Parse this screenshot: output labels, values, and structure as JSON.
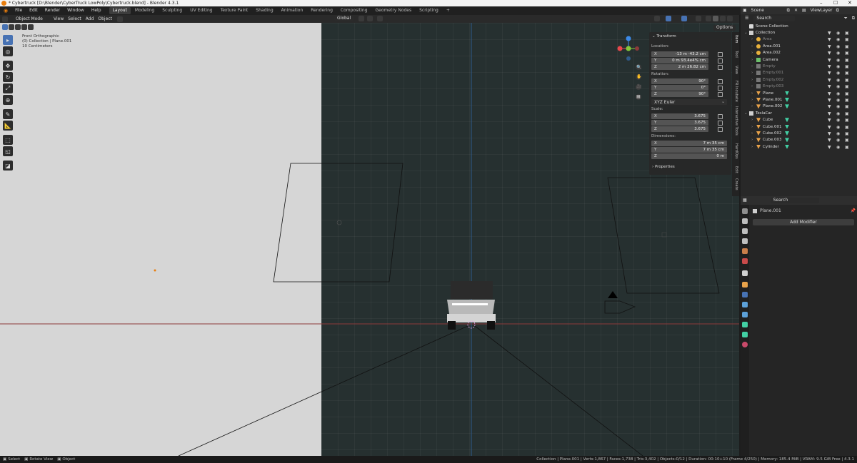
{
  "window": {
    "title": "* Cybertruck [D:\\Blender\\CyberTruck LowPoly\\Cybertruck.blend] - Blender 4.3.1"
  },
  "menu": [
    "File",
    "Edit",
    "Render",
    "Window",
    "Help"
  ],
  "workspaces": [
    "Layout",
    "Modeling",
    "Sculpting",
    "UV Editing",
    "Texture Paint",
    "Shading",
    "Animation",
    "Rendering",
    "Compositing",
    "Geometry Nodes",
    "Scripting"
  ],
  "workspace_add": "+",
  "scene": {
    "name": "Scene",
    "view_layer": "ViewLayer"
  },
  "viewport": {
    "mode": "Object Mode",
    "menus": [
      "View",
      "Select",
      "Add",
      "Object"
    ],
    "orientation": "Global",
    "options_label": "Options",
    "overlay": {
      "line1": "Front Orthographic",
      "line2": "(0) Collection | Plane.001",
      "line3": "10 Centimeters"
    }
  },
  "transform_panel": {
    "title": "Transform",
    "location_label": "Location:",
    "location": {
      "x": "-13 m -43.2 cm",
      "y": "0 m 93.4e4% cm",
      "z": "2 m 26.82 cm"
    },
    "rotation_label": "Rotation:",
    "rotation": {
      "x": "90°",
      "y": "0°",
      "z": "90°"
    },
    "rotation_mode": "XYZ Euler",
    "scale_label": "Scale:",
    "scale": {
      "x": "3.675",
      "y": "3.675",
      "z": "3.675"
    },
    "dimensions_label": "Dimensions:",
    "dimensions": {
      "x": "7 m 35 cm",
      "y": "7 m 35 cm",
      "z": "0 m"
    },
    "properties_label": "Properties",
    "axis_x": "X",
    "axis_y": "Y",
    "axis_z": "Z"
  },
  "sidebar_tabs": [
    "Item",
    "Tool",
    "View",
    "FR Incubate",
    "Interactive Tools",
    "HardOps",
    "Edit",
    "Create"
  ],
  "outliner": {
    "search_placeholder": "Search",
    "root": "Scene Collection",
    "rows": [
      {
        "name": "Collection",
        "kind": "collection",
        "level": 0
      },
      {
        "name": "Area",
        "kind": "light",
        "level": 1,
        "dim": true
      },
      {
        "name": "Area.001",
        "kind": "light",
        "level": 1
      },
      {
        "name": "Area.002",
        "kind": "light",
        "level": 1
      },
      {
        "name": "Camera",
        "kind": "camera",
        "level": 1
      },
      {
        "name": "Empty",
        "kind": "empty",
        "level": 1,
        "dim": true
      },
      {
        "name": "Empty.001",
        "kind": "empty",
        "level": 1,
        "dim": true
      },
      {
        "name": "Empty.002",
        "kind": "empty",
        "level": 1,
        "dim": true
      },
      {
        "name": "Empty.003",
        "kind": "empty",
        "level": 1,
        "dim": true
      },
      {
        "name": "Plane",
        "kind": "mesh",
        "level": 1
      },
      {
        "name": "Plane.001",
        "kind": "mesh",
        "level": 1
      },
      {
        "name": "Plane.002",
        "kind": "mesh",
        "level": 1
      },
      {
        "name": "TeslaCar",
        "kind": "collection",
        "level": 0
      },
      {
        "name": "Cube",
        "kind": "mesh",
        "level": 1
      },
      {
        "name": "Cube.001",
        "kind": "mesh",
        "level": 1
      },
      {
        "name": "Cube.002",
        "kind": "mesh",
        "level": 1
      },
      {
        "name": "Cube.003",
        "kind": "mesh",
        "level": 1
      },
      {
        "name": "Cylinder",
        "kind": "mesh",
        "level": 1
      }
    ]
  },
  "properties": {
    "search_placeholder": "Search",
    "object_name": "Plane.001",
    "add_modifier_label": "Add Modifier"
  },
  "status": {
    "select": "Select",
    "rotate": "Rotate View",
    "object": "Object",
    "stats": "Collection | Plane.001 | Verts:1,867 | Faces:1,738 | Tris:3,402 | Objects:0/12 | Duration: 00:10+10 (Frame 4/250) | Memory: 185.4 MiB | VRAM: 9.5 GiB Free | 4.3.1"
  },
  "colors": {
    "accent": "#4772b3",
    "axis_x": "#e8474b",
    "axis_y": "#85c93a",
    "axis_z": "#3c8ae8",
    "mesh_icon": "#e8a24a",
    "modifier_icon": "#42d0a4",
    "light_icon": "#e8b13c",
    "camera_icon": "#6bbf6a",
    "viewport_bg": "#263030",
    "ortho_bg": "#d6d6d6"
  }
}
